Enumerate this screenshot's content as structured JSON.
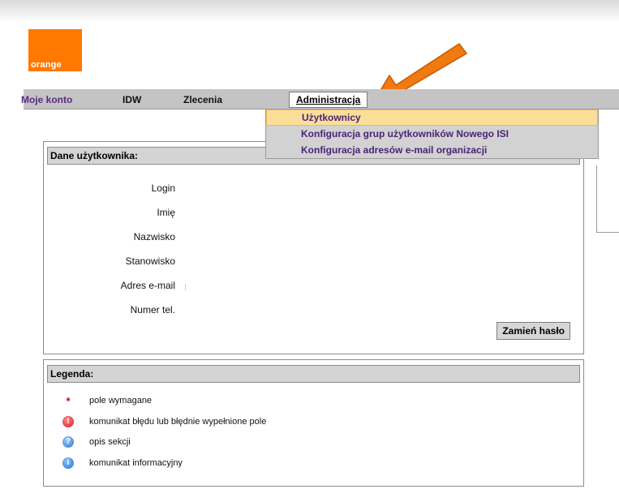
{
  "brand": {
    "logo_text": "orange",
    "color": "#ff7900"
  },
  "nav": {
    "items": [
      {
        "label": "Moje konto"
      },
      {
        "label": "IDW"
      },
      {
        "label": "Zlecenia"
      },
      {
        "label": "Administracja"
      }
    ],
    "active": "Administracja"
  },
  "dropdown": {
    "items": [
      {
        "label": "Użytkownicy",
        "highlighted": true
      },
      {
        "label": "Konfiguracja grup użytkowników Nowego ISI"
      },
      {
        "label": "Konfiguracja adresów e-mail organizacji"
      }
    ]
  },
  "user_panel": {
    "title": "Dane użytkownika:",
    "fields": [
      "Login",
      "Imię",
      "Nazwisko",
      "Stanowisko",
      "Adres e-mail",
      "Numer tel."
    ],
    "change_password_button": "Zamień hasło"
  },
  "legend": {
    "title": "Legenda:",
    "items": [
      {
        "icon": "required-star-icon",
        "text": "pole wymagane",
        "symbol": "*"
      },
      {
        "icon": "error-icon",
        "text": "komunikat błędu lub błędnie wypełnione pole",
        "symbol": "!"
      },
      {
        "icon": "help-icon",
        "text": "opis sekcji",
        "symbol": "?"
      },
      {
        "icon": "info-icon",
        "text": "komunikat informacyjny",
        "symbol": "i"
      }
    ]
  },
  "colors": {
    "accent": "#ff7900",
    "nav_link": "#5a2b80",
    "menu_highlight": "#fbdf99",
    "annotation_arrow": "#f07a10"
  }
}
